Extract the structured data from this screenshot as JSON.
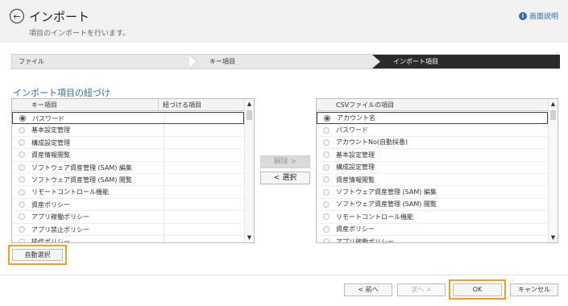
{
  "header": {
    "back_icon": "arrow-left-circle-icon",
    "title": "インポート",
    "subtitle": "項目のインポートを行います。",
    "help_icon": "info-icon",
    "help_label": "画面説明"
  },
  "steps": [
    {
      "label": "ファイル"
    },
    {
      "label": "キー項目"
    },
    {
      "label": "インポート項目",
      "active": true
    }
  ],
  "section": {
    "title": "インポート項目の紐づけ"
  },
  "left_list": {
    "columns": [
      "キー項目",
      "紐づける項目"
    ],
    "rows": [
      "パスワード",
      "基本設定管理",
      "構成設定管理",
      "資産情報閲覧",
      "ソフトウェア資産管理 (SAM) 編集",
      "ソフトウェア資産管理 (SAM) 閲覧",
      "リモートコントロール機能",
      "資産ポリシー",
      "アプリ稼働ポリシー",
      "アプリ禁止ポリシー",
      "操作ポリシー"
    ]
  },
  "right_list": {
    "columns": [
      "CSVファイルの項目"
    ],
    "rows": [
      "アカウント名",
      "パスワード",
      "アカウントNo(自動採番)",
      "基本設定管理",
      "構成設定管理",
      "資産情報閲覧",
      "ソフトウェア資産管理 (SAM) 編集",
      "ソフトウェア資産管理 (SAM) 閲覧",
      "リモートコントロール機能",
      "資産ポリシー",
      "アプリ稼働ポリシー"
    ]
  },
  "middle": {
    "remove_label": "解除 >",
    "select_label": "< 選択"
  },
  "auto_select_label": "自動選択",
  "footer": {
    "prev_label": "< 前へ",
    "next_label": "次へ >",
    "ok_label": "OK",
    "cancel_label": "キャンセル"
  },
  "colors": {
    "accent": "#2a6db5",
    "highlight": "#f0a020",
    "active_step": "#2b2b2b"
  }
}
